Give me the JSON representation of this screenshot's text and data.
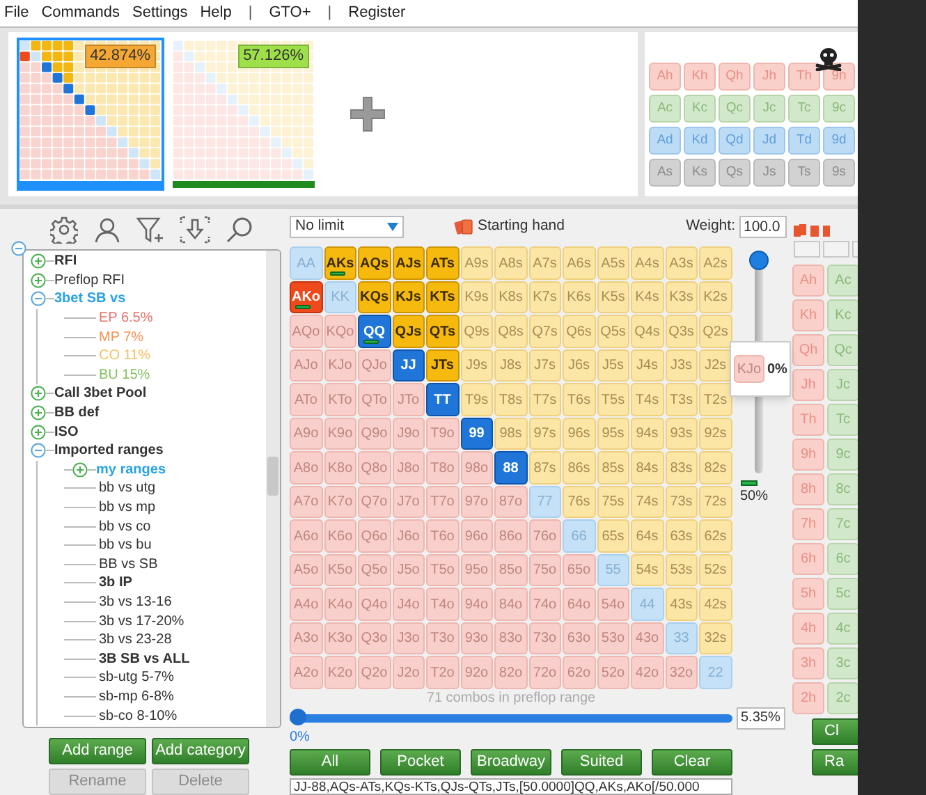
{
  "menu": [
    {
      "label": "File",
      "kind": "item"
    },
    {
      "label": "Commands",
      "kind": "item"
    },
    {
      "label": "Settings",
      "kind": "item"
    },
    {
      "label": "Help",
      "kind": "item"
    },
    {
      "label": "|",
      "kind": "separator"
    },
    {
      "label": "GTO+",
      "kind": "item"
    },
    {
      "label": "|",
      "kind": "separator"
    },
    {
      "label": "Register",
      "kind": "item"
    }
  ],
  "thumbnails": [
    {
      "percent": "42.874%",
      "selected": true,
      "color": "#f5a733"
    },
    {
      "percent": "57.126%",
      "selected": false,
      "color": "#9ee04a"
    }
  ],
  "board": [
    {
      "kind": "hearts",
      "cards": [
        "Ah",
        "Kh",
        "Qh",
        "Jh",
        "Th",
        "9h"
      ]
    },
    {
      "kind": "clubs",
      "cards": [
        "Ac",
        "Kc",
        "Qc",
        "Jc",
        "Tc",
        "9c"
      ]
    },
    {
      "kind": "diamonds",
      "cards": [
        "Ad",
        "Kd",
        "Qd",
        "Jd",
        "Td",
        "9d"
      ]
    },
    {
      "kind": "spades",
      "cards": [
        "As",
        "Ks",
        "Qs",
        "Js",
        "Ts",
        "9s"
      ]
    }
  ],
  "tree": {
    "expanded": true,
    "items": [
      {
        "label": "RFI",
        "kind": "category",
        "bold": true,
        "expanded": false
      },
      {
        "label": "Preflop RFI",
        "kind": "category",
        "bold": false,
        "expanded": false
      },
      {
        "label": "3bet SB vs",
        "kind": "category",
        "bold": true,
        "expanded": true,
        "color": "#2aa2e8",
        "children": [
          {
            "label": "EP 6.5%",
            "kind": "range",
            "bold": false,
            "color": "#e8736a"
          },
          {
            "label": "MP 7%",
            "kind": "range",
            "bold": false,
            "color": "#f29452"
          },
          {
            "label": "CO 11%",
            "kind": "range",
            "bold": false,
            "color": "#f5c164"
          },
          {
            "label": "BU 15%",
            "kind": "range",
            "bold": false,
            "color": "#86c062"
          }
        ]
      },
      {
        "label": "Call 3bet Pool",
        "kind": "category",
        "bold": true,
        "expanded": false
      },
      {
        "label": "BB def",
        "kind": "category",
        "bold": true,
        "expanded": false
      },
      {
        "label": "ISO",
        "kind": "category",
        "bold": true,
        "expanded": false
      },
      {
        "label": "Imported ranges",
        "kind": "category",
        "bold": true,
        "expanded": true,
        "children": [
          {
            "label": "my ranges",
            "kind": "category",
            "bold": true,
            "expanded": false,
            "color": "#2aa2e8"
          },
          {
            "label": "bb vs utg",
            "kind": "range",
            "bold": false
          },
          {
            "label": "bb vs mp",
            "kind": "range",
            "bold": false
          },
          {
            "label": "bb vs co",
            "kind": "range",
            "bold": false
          },
          {
            "label": "bb vs bu",
            "kind": "range",
            "bold": false
          },
          {
            "label": "BB vs SB",
            "kind": "range",
            "bold": false
          },
          {
            "label": "3b IP",
            "kind": "range",
            "bold": true
          },
          {
            "label": "3b vs 13-16",
            "kind": "range",
            "bold": false
          },
          {
            "label": "3b vs 17-20%",
            "kind": "range",
            "bold": false
          },
          {
            "label": "3b vs 23-28",
            "kind": "range",
            "bold": false
          },
          {
            "label": "3B SB vs ALL",
            "kind": "range",
            "bold": true
          },
          {
            "label": "sb-utg 5-7%",
            "kind": "range",
            "bold": false
          },
          {
            "label": "sb-mp 6-8%",
            "kind": "range",
            "bold": false
          },
          {
            "label": "sb-co 8-10%",
            "kind": "range",
            "bold": false
          }
        ]
      }
    ]
  },
  "range_buttons": [
    {
      "label": "Add range",
      "disabled": false
    },
    {
      "label": "Add category",
      "disabled": false
    },
    {
      "label": "Rename",
      "disabled": true
    },
    {
      "label": "Delete",
      "disabled": true
    }
  ],
  "limit_select": {
    "value": "No limit"
  },
  "hand_mode": {
    "label": "Starting hand"
  },
  "weight": {
    "label": "Weight:",
    "value": "100.0"
  },
  "grid": {
    "rows": [
      [
        {
          "label": "AA",
          "selected": false,
          "weighted": false
        },
        {
          "label": "AKs",
          "selected": true,
          "weighted": true
        },
        {
          "label": "AQs",
          "selected": true,
          "weighted": false
        },
        {
          "label": "AJs",
          "selected": true,
          "weighted": false
        },
        {
          "label": "ATs",
          "selected": true,
          "weighted": false
        },
        {
          "label": "A9s",
          "selected": false,
          "weighted": false
        },
        {
          "label": "A8s",
          "selected": false,
          "weighted": false
        },
        {
          "label": "A7s",
          "selected": false,
          "weighted": false
        },
        {
          "label": "A6s",
          "selected": false,
          "weighted": false
        },
        {
          "label": "A5s",
          "selected": false,
          "weighted": false
        },
        {
          "label": "A4s",
          "selected": false,
          "weighted": false
        },
        {
          "label": "A3s",
          "selected": false,
          "weighted": false
        },
        {
          "label": "A2s",
          "selected": false,
          "weighted": false
        }
      ],
      [
        {
          "label": "AKo",
          "selected": true,
          "weighted": true
        },
        {
          "label": "KK",
          "selected": false,
          "weighted": false
        },
        {
          "label": "KQs",
          "selected": true,
          "weighted": false
        },
        {
          "label": "KJs",
          "selected": true,
          "weighted": false
        },
        {
          "label": "KTs",
          "selected": true,
          "weighted": false
        },
        {
          "label": "K9s",
          "selected": false,
          "weighted": false
        },
        {
          "label": "K8s",
          "selected": false,
          "weighted": false
        },
        {
          "label": "K7s",
          "selected": false,
          "weighted": false
        },
        {
          "label": "K6s",
          "selected": false,
          "weighted": false
        },
        {
          "label": "K5s",
          "selected": false,
          "weighted": false
        },
        {
          "label": "K4s",
          "selected": false,
          "weighted": false
        },
        {
          "label": "K3s",
          "selected": false,
          "weighted": false
        },
        {
          "label": "K2s",
          "selected": false,
          "weighted": false
        }
      ],
      [
        {
          "label": "AQo",
          "selected": false,
          "weighted": false
        },
        {
          "label": "KQo",
          "selected": false,
          "weighted": false
        },
        {
          "label": "QQ",
          "selected": true,
          "weighted": true
        },
        {
          "label": "QJs",
          "selected": true,
          "weighted": false
        },
        {
          "label": "QTs",
          "selected": true,
          "weighted": false
        },
        {
          "label": "Q9s",
          "selected": false,
          "weighted": false
        },
        {
          "label": "Q8s",
          "selected": false,
          "weighted": false
        },
        {
          "label": "Q7s",
          "selected": false,
          "weighted": false
        },
        {
          "label": "Q6s",
          "selected": false,
          "weighted": false
        },
        {
          "label": "Q5s",
          "selected": false,
          "weighted": false
        },
        {
          "label": "Q4s",
          "selected": false,
          "weighted": false
        },
        {
          "label": "Q3s",
          "selected": false,
          "weighted": false
        },
        {
          "label": "Q2s",
          "selected": false,
          "weighted": false
        }
      ],
      [
        {
          "label": "AJo",
          "selected": false,
          "weighted": false
        },
        {
          "label": "KJo",
          "selected": false,
          "weighted": false
        },
        {
          "label": "QJo",
          "selected": false,
          "weighted": false
        },
        {
          "label": "JJ",
          "selected": true,
          "weighted": false
        },
        {
          "label": "JTs",
          "selected": true,
          "weighted": false
        },
        {
          "label": "J9s",
          "selected": false,
          "weighted": false
        },
        {
          "label": "J8s",
          "selected": false,
          "weighted": false
        },
        {
          "label": "J7s",
          "selected": false,
          "weighted": false
        },
        {
          "label": "J6s",
          "selected": false,
          "weighted": false
        },
        {
          "label": "J5s",
          "selected": false,
          "weighted": false
        },
        {
          "label": "J4s",
          "selected": false,
          "weighted": false
        },
        {
          "label": "J3s",
          "selected": false,
          "weighted": false
        },
        {
          "label": "J2s",
          "selected": false,
          "weighted": false
        }
      ],
      [
        {
          "label": "ATo",
          "selected": false,
          "weighted": false
        },
        {
          "label": "KTo",
          "selected": false,
          "weighted": false
        },
        {
          "label": "QTo",
          "selected": false,
          "weighted": false
        },
        {
          "label": "JTo",
          "selected": false,
          "weighted": false
        },
        {
          "label": "TT",
          "selected": true,
          "weighted": false
        },
        {
          "label": "T9s",
          "selected": false,
          "weighted": false
        },
        {
          "label": "T8s",
          "selected": false,
          "weighted": false
        },
        {
          "label": "T7s",
          "selected": false,
          "weighted": false
        },
        {
          "label": "T6s",
          "selected": false,
          "weighted": false
        },
        {
          "label": "T5s",
          "selected": false,
          "weighted": false
        },
        {
          "label": "T4s",
          "selected": false,
          "weighted": false
        },
        {
          "label": "T3s",
          "selected": false,
          "weighted": false
        },
        {
          "label": "T2s",
          "selected": false,
          "weighted": false
        }
      ],
      [
        {
          "label": "A9o",
          "selected": false,
          "weighted": false
        },
        {
          "label": "K9o",
          "selected": false,
          "weighted": false
        },
        {
          "label": "Q9o",
          "selected": false,
          "weighted": false
        },
        {
          "label": "J9o",
          "selected": false,
          "weighted": false
        },
        {
          "label": "T9o",
          "selected": false,
          "weighted": false
        },
        {
          "label": "99",
          "selected": true,
          "weighted": false
        },
        {
          "label": "98s",
          "selected": false,
          "weighted": false
        },
        {
          "label": "97s",
          "selected": false,
          "weighted": false
        },
        {
          "label": "96s",
          "selected": false,
          "weighted": false
        },
        {
          "label": "95s",
          "selected": false,
          "weighted": false
        },
        {
          "label": "94s",
          "selected": false,
          "weighted": false
        },
        {
          "label": "93s",
          "selected": false,
          "weighted": false
        },
        {
          "label": "92s",
          "selected": false,
          "weighted": false
        }
      ],
      [
        {
          "label": "A8o",
          "selected": false,
          "weighted": false
        },
        {
          "label": "K8o",
          "selected": false,
          "weighted": false
        },
        {
          "label": "Q8o",
          "selected": false,
          "weighted": false
        },
        {
          "label": "J8o",
          "selected": false,
          "weighted": false
        },
        {
          "label": "T8o",
          "selected": false,
          "weighted": false
        },
        {
          "label": "98o",
          "selected": false,
          "weighted": false
        },
        {
          "label": "88",
          "selected": true,
          "weighted": false
        },
        {
          "label": "87s",
          "selected": false,
          "weighted": false
        },
        {
          "label": "86s",
          "selected": false,
          "weighted": false
        },
        {
          "label": "85s",
          "selected": false,
          "weighted": false
        },
        {
          "label": "84s",
          "selected": false,
          "weighted": false
        },
        {
          "label": "83s",
          "selected": false,
          "weighted": false
        },
        {
          "label": "82s",
          "selected": false,
          "weighted": false
        }
      ],
      [
        {
          "label": "A7o",
          "selected": false,
          "weighted": false
        },
        {
          "label": "K7o",
          "selected": false,
          "weighted": false
        },
        {
          "label": "Q7o",
          "selected": false,
          "weighted": false
        },
        {
          "label": "J7o",
          "selected": false,
          "weighted": false
        },
        {
          "label": "T7o",
          "selected": false,
          "weighted": false
        },
        {
          "label": "97o",
          "selected": false,
          "weighted": false
        },
        {
          "label": "87o",
          "selected": false,
          "weighted": false
        },
        {
          "label": "77",
          "selected": false,
          "weighted": false
        },
        {
          "label": "76s",
          "selected": false,
          "weighted": false
        },
        {
          "label": "75s",
          "selected": false,
          "weighted": false
        },
        {
          "label": "74s",
          "selected": false,
          "weighted": false
        },
        {
          "label": "73s",
          "selected": false,
          "weighted": false
        },
        {
          "label": "72s",
          "selected": false,
          "weighted": false
        }
      ],
      [
        {
          "label": "A6o",
          "selected": false,
          "weighted": false
        },
        {
          "label": "K6o",
          "selected": false,
          "weighted": false
        },
        {
          "label": "Q6o",
          "selected": false,
          "weighted": false
        },
        {
          "label": "J6o",
          "selected": false,
          "weighted": false
        },
        {
          "label": "T6o",
          "selected": false,
          "weighted": false
        },
        {
          "label": "96o",
          "selected": false,
          "weighted": false
        },
        {
          "label": "86o",
          "selected": false,
          "weighted": false
        },
        {
          "label": "76o",
          "selected": false,
          "weighted": false
        },
        {
          "label": "66",
          "selected": false,
          "weighted": false
        },
        {
          "label": "65s",
          "selected": false,
          "weighted": false
        },
        {
          "label": "64s",
          "selected": false,
          "weighted": false
        },
        {
          "label": "63s",
          "selected": false,
          "weighted": false
        },
        {
          "label": "62s",
          "selected": false,
          "weighted": false
        }
      ],
      [
        {
          "label": "A5o",
          "selected": false,
          "weighted": false
        },
        {
          "label": "K5o",
          "selected": false,
          "weighted": false
        },
        {
          "label": "Q5o",
          "selected": false,
          "weighted": false
        },
        {
          "label": "J5o",
          "selected": false,
          "weighted": false
        },
        {
          "label": "T5o",
          "selected": false,
          "weighted": false
        },
        {
          "label": "95o",
          "selected": false,
          "weighted": false
        },
        {
          "label": "85o",
          "selected": false,
          "weighted": false
        },
        {
          "label": "75o",
          "selected": false,
          "weighted": false
        },
        {
          "label": "65o",
          "selected": false,
          "weighted": false
        },
        {
          "label": "55",
          "selected": false,
          "weighted": false
        },
        {
          "label": "54s",
          "selected": false,
          "weighted": false
        },
        {
          "label": "53s",
          "selected": false,
          "weighted": false
        },
        {
          "label": "52s",
          "selected": false,
          "weighted": false
        }
      ],
      [
        {
          "label": "A4o",
          "selected": false,
          "weighted": false
        },
        {
          "label": "K4o",
          "selected": false,
          "weighted": false
        },
        {
          "label": "Q4o",
          "selected": false,
          "weighted": false
        },
        {
          "label": "J4o",
          "selected": false,
          "weighted": false
        },
        {
          "label": "T4o",
          "selected": false,
          "weighted": false
        },
        {
          "label": "94o",
          "selected": false,
          "weighted": false
        },
        {
          "label": "84o",
          "selected": false,
          "weighted": false
        },
        {
          "label": "74o",
          "selected": false,
          "weighted": false
        },
        {
          "label": "64o",
          "selected": false,
          "weighted": false
        },
        {
          "label": "54o",
          "selected": false,
          "weighted": false
        },
        {
          "label": "44",
          "selected": false,
          "weighted": false
        },
        {
          "label": "43s",
          "selected": false,
          "weighted": false
        },
        {
          "label": "42s",
          "selected": false,
          "weighted": false
        }
      ],
      [
        {
          "label": "A3o",
          "selected": false,
          "weighted": false
        },
        {
          "label": "K3o",
          "selected": false,
          "weighted": false
        },
        {
          "label": "Q3o",
          "selected": false,
          "weighted": false
        },
        {
          "label": "J3o",
          "selected": false,
          "weighted": false
        },
        {
          "label": "T3o",
          "selected": false,
          "weighted": false
        },
        {
          "label": "93o",
          "selected": false,
          "weighted": false
        },
        {
          "label": "83o",
          "selected": false,
          "weighted": false
        },
        {
          "label": "73o",
          "selected": false,
          "weighted": false
        },
        {
          "label": "63o",
          "selected": false,
          "weighted": false
        },
        {
          "label": "53o",
          "selected": false,
          "weighted": false
        },
        {
          "label": "43o",
          "selected": false,
          "weighted": false
        },
        {
          "label": "33",
          "selected": false,
          "weighted": false
        },
        {
          "label": "32s",
          "selected": false,
          "weighted": false
        }
      ],
      [
        {
          "label": "A2o",
          "selected": false,
          "weighted": false
        },
        {
          "label": "K2o",
          "selected": false,
          "weighted": false
        },
        {
          "label": "Q2o",
          "selected": false,
          "weighted": false
        },
        {
          "label": "J2o",
          "selected": false,
          "weighted": false
        },
        {
          "label": "T2o",
          "selected": false,
          "weighted": false
        },
        {
          "label": "92o",
          "selected": false,
          "weighted": false
        },
        {
          "label": "82o",
          "selected": false,
          "weighted": false
        },
        {
          "label": "72o",
          "selected": false,
          "weighted": false
        },
        {
          "label": "62o",
          "selected": false,
          "weighted": false
        },
        {
          "label": "52o",
          "selected": false,
          "weighted": false
        },
        {
          "label": "42o",
          "selected": false,
          "weighted": false
        },
        {
          "label": "32o",
          "selected": false,
          "weighted": false
        },
        {
          "label": "22",
          "selected": false,
          "weighted": false
        }
      ]
    ]
  },
  "weight_slider": {
    "level": 1,
    "reading": "50%"
  },
  "hover_popup": {
    "hand": "KJo",
    "weight": "0%"
  },
  "combos_text": "71 combos in preflop range",
  "percent_slider": {
    "level": 0,
    "reading": "0%",
    "value": "5.35%"
  },
  "preset_buttons": [
    "All",
    "Pocket",
    "Broadway",
    "Suited",
    "Clear"
  ],
  "range_text": "JJ-88,AQs-ATs,KQs-KTs,QJs-QTs,JTs,[50.0000]QQ,AKs,AKo[/50.000",
  "hole_cards": [
    {
      "kind": "hearts",
      "cards": [
        "Ah",
        "Kh",
        "Qh",
        "Jh",
        "Th",
        "9h",
        "8h",
        "7h",
        "6h",
        "5h",
        "4h",
        "3h",
        "2h"
      ]
    },
    {
      "kind": "clubs",
      "cards": [
        "Ac",
        "Kc",
        "Qc",
        "Jc",
        "Tc",
        "9c",
        "8c",
        "7c",
        "6c",
        "5c",
        "4c",
        "3c",
        "2c"
      ]
    }
  ],
  "side_buttons": [
    "Cl",
    "Ra"
  ]
}
